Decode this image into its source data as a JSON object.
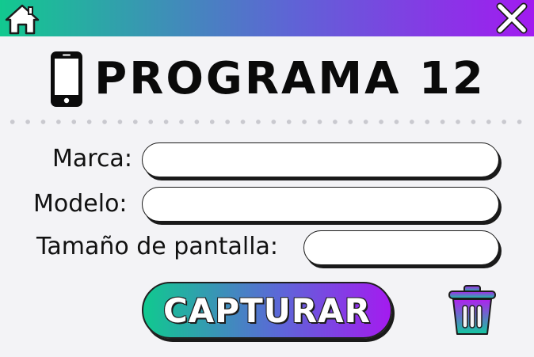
{
  "header": {
    "home_icon": "home-icon",
    "close_icon": "close-icon",
    "gradient": [
      "#12c98f",
      "#5f63d6",
      "#a21af0"
    ]
  },
  "title": {
    "icon": "smartphone-icon",
    "text": "PROGRAMA 12"
  },
  "form": {
    "brand": {
      "label": "Marca:",
      "value": ""
    },
    "model": {
      "label": "Modelo:",
      "value": ""
    },
    "screen_size": {
      "label": "Tamaño de pantalla:",
      "value": ""
    }
  },
  "actions": {
    "capture_label": "CAPTURAR",
    "delete_icon": "trash-icon"
  }
}
